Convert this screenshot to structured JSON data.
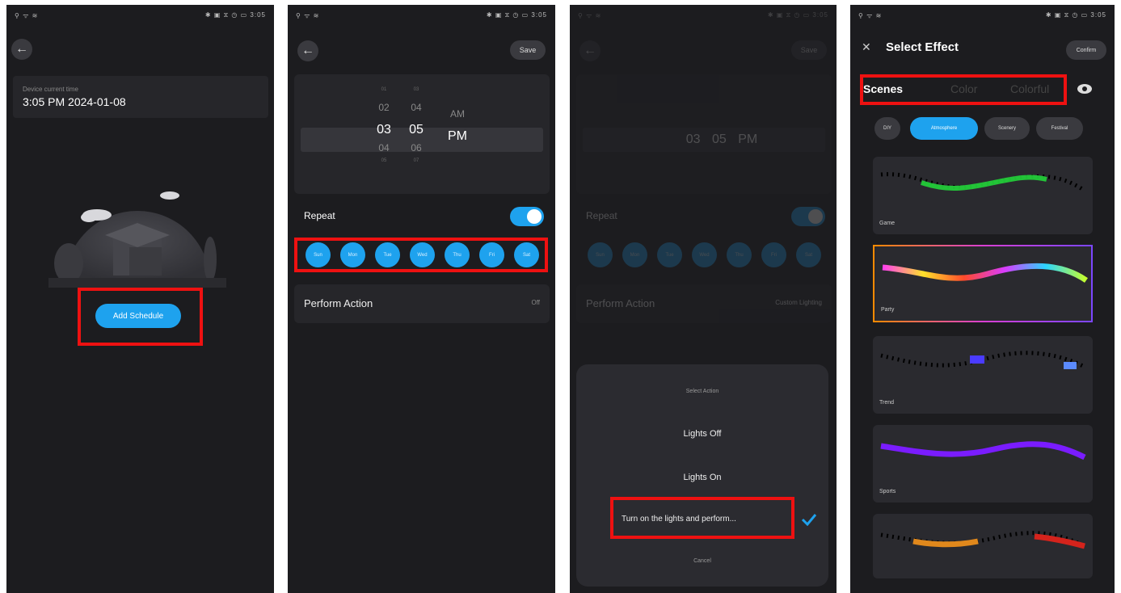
{
  "status_bar": {
    "left": "⚲ ᯤ ≋",
    "right": "✱ ▣ ⧖ ◷ ▭ 3:05"
  },
  "p1": {
    "time_label": "Device current time",
    "time_value": "3:05 PM 2024-01-08",
    "add_button": "Add Schedule"
  },
  "p2": {
    "save": "Save",
    "picker": {
      "hours": [
        "01",
        "02",
        "03",
        "04",
        "05"
      ],
      "minutes": [
        "03",
        "04",
        "05",
        "06",
        "07"
      ],
      "ampm": [
        "AM",
        "PM"
      ]
    },
    "repeat_label": "Repeat",
    "days": [
      "Sun",
      "Mon",
      "Tue",
      "Wed",
      "Thu",
      "Fri",
      "Sat"
    ],
    "perform_label": "Perform Action",
    "perform_value": "Off"
  },
  "p3": {
    "sheet_title": "Select Action",
    "options": [
      "Lights Off",
      "Lights On",
      "Turn on the lights and perform..."
    ],
    "cancel": "Cancel",
    "perform_value": "Custom Lighting"
  },
  "p4": {
    "title": "Select Effect",
    "confirm": "Confirm",
    "tabs": [
      "Scenes",
      "Color",
      "Colorful"
    ],
    "chips": [
      "DIY",
      "Atmosphere",
      "Scenery",
      "Festival"
    ],
    "effects": [
      "Game",
      "Party",
      "Trend",
      "Sports"
    ]
  },
  "colors": {
    "accent": "#1ea2ee",
    "highlight": "#e11111",
    "bg": "#1c1c1f"
  }
}
